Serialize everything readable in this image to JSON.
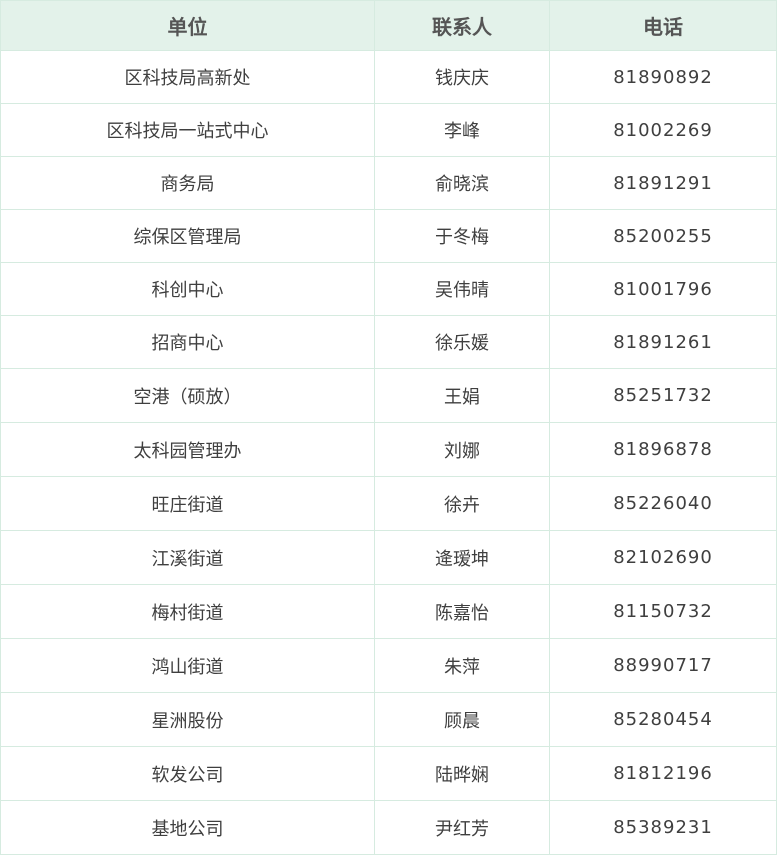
{
  "table": {
    "headers": [
      "单位",
      "联系人",
      "电话"
    ],
    "rows": [
      {
        "unit": "区科技局高新处",
        "contact": "钱庆庆",
        "phone": "81890892"
      },
      {
        "unit": "区科技局一站式中心",
        "contact": "李峰",
        "phone": "81002269"
      },
      {
        "unit": "商务局",
        "contact": "俞晓滨",
        "phone": "81891291"
      },
      {
        "unit": "综保区管理局",
        "contact": "于冬梅",
        "phone": "85200255"
      },
      {
        "unit": "科创中心",
        "contact": "吴伟晴",
        "phone": "81001796"
      },
      {
        "unit": "招商中心",
        "contact": "徐乐媛",
        "phone": "81891261"
      },
      {
        "unit": "空港（硕放）",
        "contact": "王娟",
        "phone": "85251732"
      },
      {
        "unit": "太科园管理办",
        "contact": "刘娜",
        "phone": "81896878"
      },
      {
        "unit": "旺庄街道",
        "contact": "徐卉",
        "phone": "85226040"
      },
      {
        "unit": "江溪街道",
        "contact": "逄瑷坤",
        "phone": "82102690"
      },
      {
        "unit": "梅村街道",
        "contact": "陈嘉怡",
        "phone": "81150732"
      },
      {
        "unit": "鸿山街道",
        "contact": "朱萍",
        "phone": "88990717"
      },
      {
        "unit": "星洲股份",
        "contact": "顾晨",
        "phone": "85280454"
      },
      {
        "unit": "软发公司",
        "contact": "陆晔娴",
        "phone": "81812196"
      },
      {
        "unit": "基地公司",
        "contact": "尹红芳",
        "phone": "85389231"
      }
    ]
  }
}
